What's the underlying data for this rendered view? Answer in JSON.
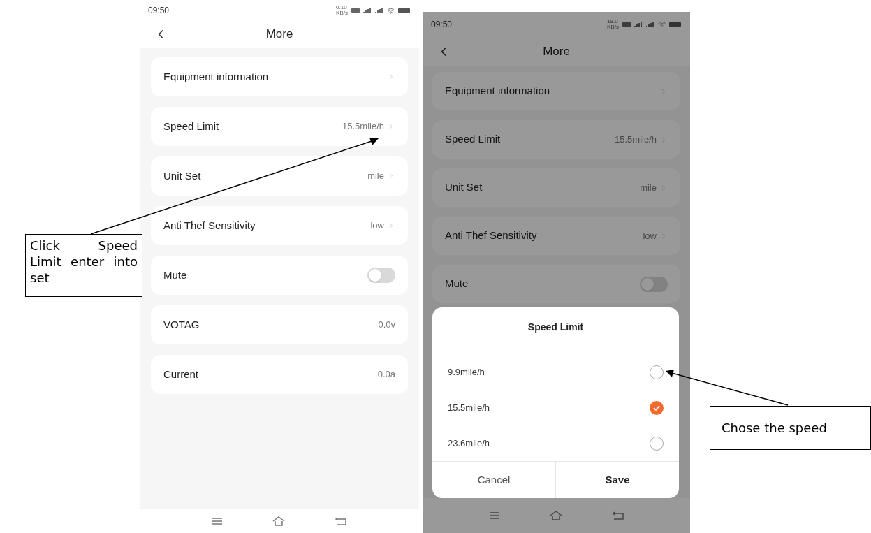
{
  "screens": [
    {
      "dimmed": false,
      "status_bar": {
        "time": "09:50",
        "net_speed": "0.10",
        "net_unit": "KB/s"
      },
      "header": {
        "title": "More"
      },
      "rows": [
        {
          "kind": "link",
          "label": "Equipment information"
        },
        {
          "kind": "link",
          "label": "Speed Limit",
          "value": "15.5mile/h"
        },
        {
          "kind": "link",
          "label": "Unit Set",
          "value": "mile"
        },
        {
          "kind": "link",
          "label": "Anti Thef Sensitivity",
          "value": "low"
        },
        {
          "kind": "toggle",
          "label": "Mute",
          "on": false
        },
        {
          "kind": "info",
          "label": "VOTAG",
          "value": "0.0v"
        },
        {
          "kind": "info",
          "label": "Current",
          "value": "0.0a"
        }
      ]
    },
    {
      "dimmed": true,
      "status_bar": {
        "time": "09:50",
        "net_speed": "18.0",
        "net_unit": "KB/s"
      },
      "header": {
        "title": "More"
      },
      "rows": [
        {
          "kind": "link",
          "label": "Equipment information"
        },
        {
          "kind": "link",
          "label": "Speed Limit",
          "value": "15.5mile/h"
        },
        {
          "kind": "link",
          "label": "Unit Set",
          "value": "mile"
        },
        {
          "kind": "link",
          "label": "Anti Thef Sensitivity",
          "value": "low"
        },
        {
          "kind": "toggle",
          "label": "Mute",
          "on": false
        }
      ],
      "dialog": {
        "title": "Speed Limit",
        "options": [
          {
            "label": "9.9mile/h",
            "selected": false
          },
          {
            "label": "15.5mile/h",
            "selected": true
          },
          {
            "label": "23.6mile/h",
            "selected": false
          }
        ],
        "buttons": [
          {
            "label": "Cancel",
            "primary": false
          },
          {
            "label": "Save",
            "primary": true
          }
        ]
      }
    }
  ],
  "annotations": [
    {
      "text": "Click Speed Limit enter into set"
    },
    {
      "text": "Chose the speed"
    }
  ]
}
